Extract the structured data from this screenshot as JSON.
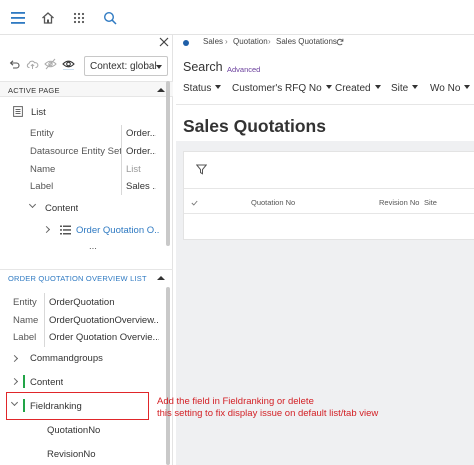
{
  "topbar": {
    "icons": [
      "hamburger-menu-icon",
      "home-icon",
      "apps-grid-icon",
      "search-icon"
    ],
    "accent": "#2f7ac2"
  },
  "left_panel": {
    "toolbar_icons": [
      "undo-icon",
      "cloud-upload-icon",
      "hide-icon",
      "visibility-icon"
    ],
    "context_select": {
      "value": "Context: global"
    },
    "active_page": {
      "heading": "ACTIVE PAGE",
      "node_label": "List",
      "properties": [
        {
          "key": "Entity",
          "value": "Order..."
        },
        {
          "key": "Datasource Entity Set",
          "value": "Order..."
        },
        {
          "key": "Name",
          "value": "List"
        },
        {
          "key": "Label",
          "value": "Sales ..."
        }
      ],
      "content_label": "Content",
      "selected_item": "Order Quotation O...",
      "more": "..."
    },
    "overview": {
      "heading": "ORDER QUOTATION OVERVIEW LIST",
      "properties": [
        {
          "key": "Entity",
          "value": "OrderQuotation"
        },
        {
          "key": "Name",
          "value": "OrderQuotationOverview..."
        },
        {
          "key": "Label",
          "value": "Order Quotation Overvie..."
        }
      ],
      "tree": [
        {
          "label": "Commandgroups"
        },
        {
          "label": "Content"
        },
        {
          "label": "Fieldranking"
        }
      ],
      "children": [
        "QuotationNo",
        "RevisionNo"
      ]
    }
  },
  "main": {
    "breadcrumb": [
      "Sales",
      "Quotation",
      "Sales Quotations"
    ],
    "breadcrumb_sep": "›",
    "search_title": "Search",
    "advanced_link": "Advanced",
    "filters": [
      "Status",
      "Customer's RFQ No",
      "Created",
      "Site",
      "Wo No"
    ],
    "page_title": "Sales Quotations",
    "columns": [
      "Quotation No",
      "Revision No",
      "Site"
    ]
  },
  "annotation": {
    "line1": "Add the field in Fieldranking or delete",
    "line2": "this setting to fix display issue on default list/tab view",
    "color": "#e0262a"
  }
}
